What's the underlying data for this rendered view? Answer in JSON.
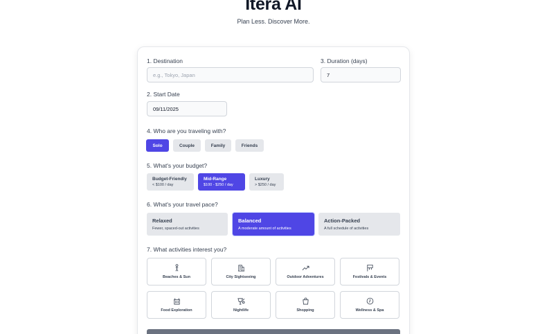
{
  "header": {
    "title": "Itera AI",
    "tagline": "Plan Less. Discover More."
  },
  "form": {
    "destination": {
      "label": "1. Destination",
      "placeholder": "e.g., Tokyo, Japan",
      "value": ""
    },
    "duration": {
      "label": "3. Duration (days)",
      "value": "7"
    },
    "start_date": {
      "label": "2. Start Date",
      "value": "09/11/2025"
    },
    "companions": {
      "label": "4. Who are you traveling with?",
      "options": [
        "Solo",
        "Couple",
        "Family",
        "Friends"
      ],
      "selected": "Solo"
    },
    "budget": {
      "label": "5. What's your budget?",
      "options": [
        {
          "title": "Budget-Friendly",
          "subtitle": "< $100 / day"
        },
        {
          "title": "Mid-Range",
          "subtitle": "$100 - $250 / day"
        },
        {
          "title": "Luxury",
          "subtitle": "> $250 / day"
        }
      ],
      "selected": "Mid-Range"
    },
    "pace": {
      "label": "6. What's your travel pace?",
      "options": [
        {
          "title": "Relaxed",
          "subtitle": "Fewer, spaced-out activities"
        },
        {
          "title": "Balanced",
          "subtitle": "A moderate amount of activities"
        },
        {
          "title": "Action-Packed",
          "subtitle": "A full schedule of activities"
        }
      ],
      "selected": "Balanced"
    },
    "activities": {
      "label": "7. What activities interest you?",
      "options": [
        {
          "label": "Beaches & Sun",
          "icon": "person-icon"
        },
        {
          "label": "City Sightseeing",
          "icon": "building-icon"
        },
        {
          "label": "Outdoor Adventures",
          "icon": "trend-up-icon"
        },
        {
          "label": "Festivals & Events",
          "icon": "flag-icon"
        },
        {
          "label": "Food Exploration",
          "icon": "food-icon"
        },
        {
          "label": "Nightlife",
          "icon": "drink-icon"
        },
        {
          "label": "Shopping",
          "icon": "shopping-bag-icon"
        },
        {
          "label": "Wellness & Spa",
          "icon": "spa-icon"
        }
      ]
    }
  },
  "colors": {
    "accent": "#4f46e5",
    "option_bg": "#e5e7eb",
    "submit_bg": "#6b7280"
  }
}
